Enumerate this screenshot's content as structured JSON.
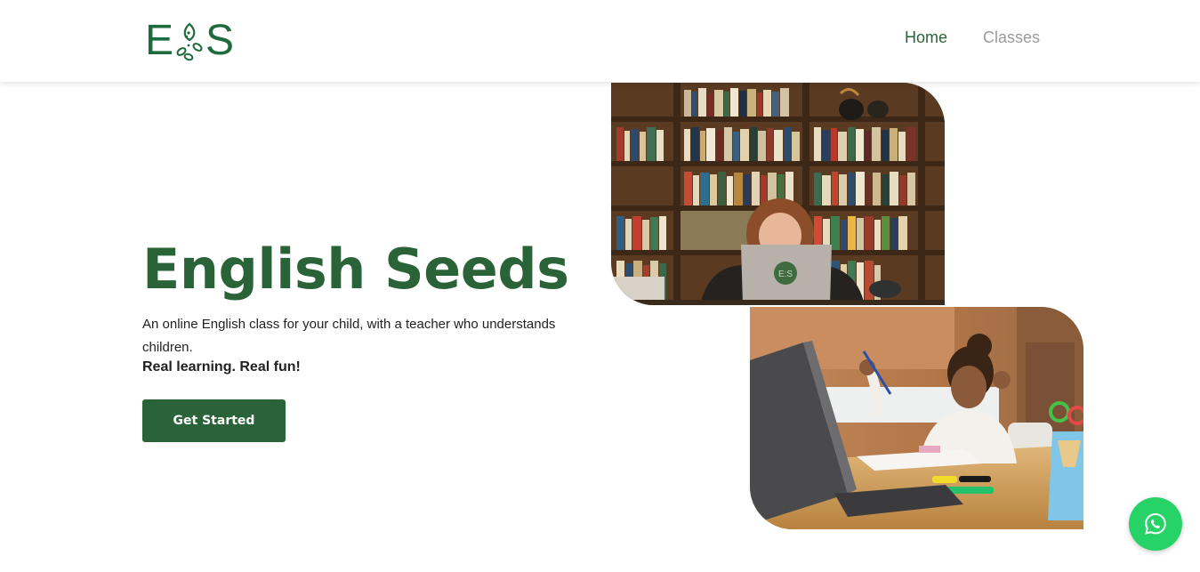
{
  "header": {
    "logo": {
      "left": "E",
      "right": "S",
      "icon": "seeds-logo-icon"
    },
    "nav": [
      {
        "label": "Home",
        "active": true
      },
      {
        "label": "Classes",
        "active": false
      }
    ]
  },
  "hero": {
    "title": "English Seeds",
    "description": "An online English class for your child, with a teacher who understands children.",
    "tagline": "Real learning. Real fun!",
    "cta_label": "Get Started"
  },
  "images": {
    "photo_1": "girl-studying-laptop-bookshelf-photo",
    "photo_2": "girl-raising-hand-laptop-class-photo",
    "laptop_logo": "E:S"
  },
  "floating": {
    "icon": "whatsapp-icon"
  },
  "colors": {
    "brand_green": "#2b6338",
    "logo_green": "#1e6b3f",
    "nav_inactive": "#9a9a9a",
    "whatsapp_green": "#25d366"
  }
}
